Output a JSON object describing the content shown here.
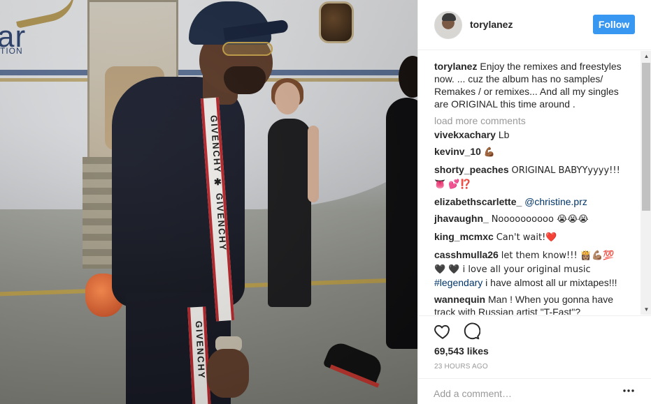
{
  "photo": {
    "alt": "",
    "logo_text": "ar",
    "logo_sub": "TION",
    "brand_upper": "GIVENCHY ✱ GIVENCHY",
    "brand_lower": "GIVENCHY"
  },
  "header": {
    "username": "torylanez",
    "follow_label": "Follow"
  },
  "caption": {
    "username": "torylanez",
    "text": "Enjoy the remixes and freestyles now. ... cuz the album has no samples/ Remakes / or remixes... And all my singles are ORIGINAL this time around ."
  },
  "load_more_label": "load more comments",
  "comments": [
    {
      "username": "vivekxachary",
      "text": "Lb"
    },
    {
      "username": "kevinv_10",
      "text": "💪🏾"
    },
    {
      "username": "shorty_peaches",
      "text": "ORIGINAL BABYYyyyy!!! 👅 💕⁉️"
    },
    {
      "username": "elizabethscarlette_",
      "mention": "@christine.prz",
      "text": ""
    },
    {
      "username": "jhavaughn_",
      "text": "Noooooooooo 😭😭😭"
    },
    {
      "username": "king_mcmxc",
      "text": "Can't wait!❤️"
    },
    {
      "username": "casshmulla26",
      "text": "let them know!!! 👸🏽💪🏽💯🖤 🖤 i love all your original music",
      "tag": "#legendary",
      "text2": "i have almost all ur mixtapes!!!"
    },
    {
      "username": "wannequin",
      "text": "Man ! When you gonna have track with Russian artist \"T-Fast\"?"
    }
  ],
  "actions": {
    "likes": "69,543 likes",
    "time": "23 HOURS AGO"
  },
  "add_comment": {
    "placeholder": "Add a comment…"
  },
  "icons": {
    "like": "heart-icon",
    "comment": "comment-icon",
    "more": "more-options-icon"
  },
  "colors": {
    "follow_button": "#3897f0",
    "text": "#262626",
    "muted": "#999999",
    "link": "#003569"
  }
}
